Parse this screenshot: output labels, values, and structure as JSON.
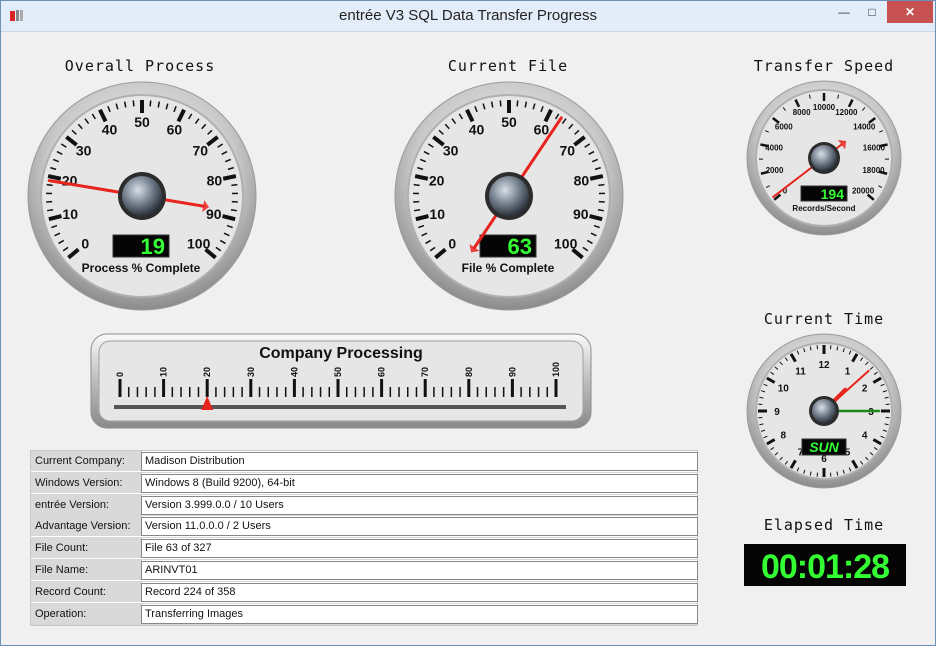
{
  "window": {
    "title": "entrée V3 SQL Data Transfer Progress",
    "controls": {
      "minimize": "—",
      "maximize": "□",
      "close": "✕"
    }
  },
  "gauges": {
    "overall": {
      "title": "Overall Process",
      "caption": "Process % Complete",
      "ticks": [
        "0",
        "10",
        "20",
        "30",
        "40",
        "50",
        "60",
        "70",
        "80",
        "90",
        "100"
      ],
      "display": "19",
      "value": 19
    },
    "current_file": {
      "title": "Current File",
      "caption": "File % Complete",
      "ticks": [
        "0",
        "10",
        "20",
        "30",
        "40",
        "50",
        "60",
        "70",
        "80",
        "90",
        "100"
      ],
      "display": "63",
      "value": 63
    },
    "transfer_speed": {
      "title": "Transfer Speed",
      "caption": "Records/Second",
      "ticks": [
        "0",
        "2000",
        "4000",
        "6000",
        "8000",
        "10000",
        "12000",
        "14000",
        "16000",
        "18000",
        "20000"
      ],
      "display": "194",
      "value": 194
    },
    "current_time": {
      "title": "Current Time",
      "ticks": [
        "12",
        "1",
        "2",
        "3",
        "4",
        "5",
        "6",
        "7",
        "8",
        "9",
        "10",
        "11"
      ],
      "day": "SUN",
      "hour": 1.5,
      "minute": 15,
      "second": 38
    }
  },
  "company_processing": {
    "title": "Company Processing",
    "ticks": [
      "0",
      "10",
      "20",
      "30",
      "40",
      "50",
      "60",
      "70",
      "80",
      "90",
      "100"
    ],
    "value": 20
  },
  "elapsed": {
    "title": "Elapsed Time",
    "value": "00:01:28"
  },
  "info": {
    "rows": [
      {
        "label": "Current Company:",
        "value": "Madison Distribution"
      },
      {
        "label": "Windows Version:",
        "value": "Windows 8 (Build 9200), 64-bit"
      },
      {
        "label": "entrée Version:",
        "value": "Version 3.999.0.0 / 10 Users"
      },
      {
        "label": "Advantage Version:",
        "value": "Version 11.0.0.0 / 2 Users"
      },
      {
        "label": "File Count:",
        "value": "File 63 of 327"
      },
      {
        "label": "File Name:",
        "value": "ARINVT01"
      },
      {
        "label": "Record Count:",
        "value": "Record 224 of 358"
      },
      {
        "label": "Operation:",
        "value": "Transferring Images"
      }
    ]
  },
  "colors": {
    "needle": "#e8241e",
    "digit": "#33ff33",
    "second_hand": "#1a8a1a"
  }
}
